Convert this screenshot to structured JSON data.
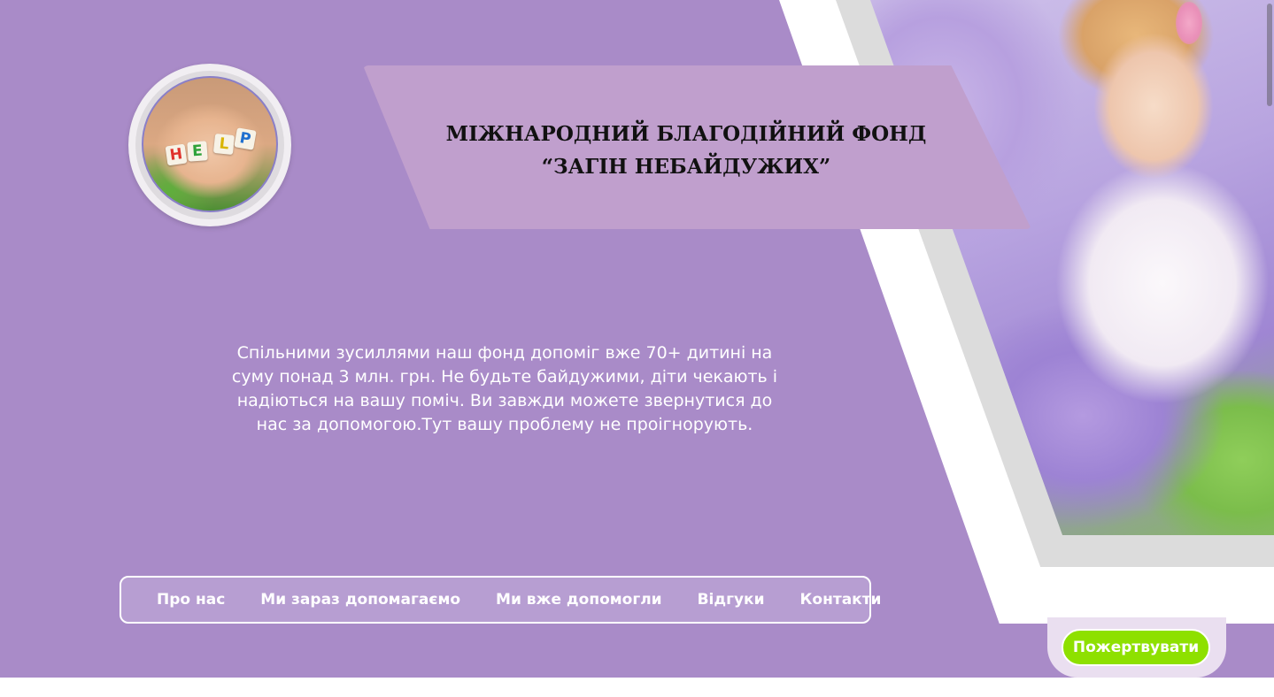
{
  "header": {
    "title_line1": "МІЖНАРОДНИЙ БЛАГОДІЙНИЙ ФОНД",
    "title_line2": "“ЗАГІН НЕБАЙДУЖИХ”"
  },
  "logo": {
    "blocks": [
      "H",
      "E",
      "L",
      "P"
    ],
    "icon": "help-blocks-hands-icon"
  },
  "hero": {
    "description": "Спільними зусиллями наш фонд допоміг вже 70+ дитині на суму понад 3 млн. грн. Не будьте байдужими, діти чекають і надіються на вашу поміч. Ви завжди можете звернутися до нас за допомогою.Тут вашу проблему не проігнорують.",
    "photo_icon": "child-in-lavender-field-photo"
  },
  "nav": {
    "items": [
      {
        "label": "Про нас"
      },
      {
        "label": "Ми зараз допомагаємо"
      },
      {
        "label": "Ми вже допомогли"
      },
      {
        "label": "Відгуки"
      },
      {
        "label": "Контакти"
      }
    ]
  },
  "donate": {
    "label": "Пожертвувати"
  },
  "colors": {
    "background": "#a98bc8",
    "banner": "#c09fcd",
    "donate": "#8ee000",
    "nav_background": "#b79ed2"
  }
}
